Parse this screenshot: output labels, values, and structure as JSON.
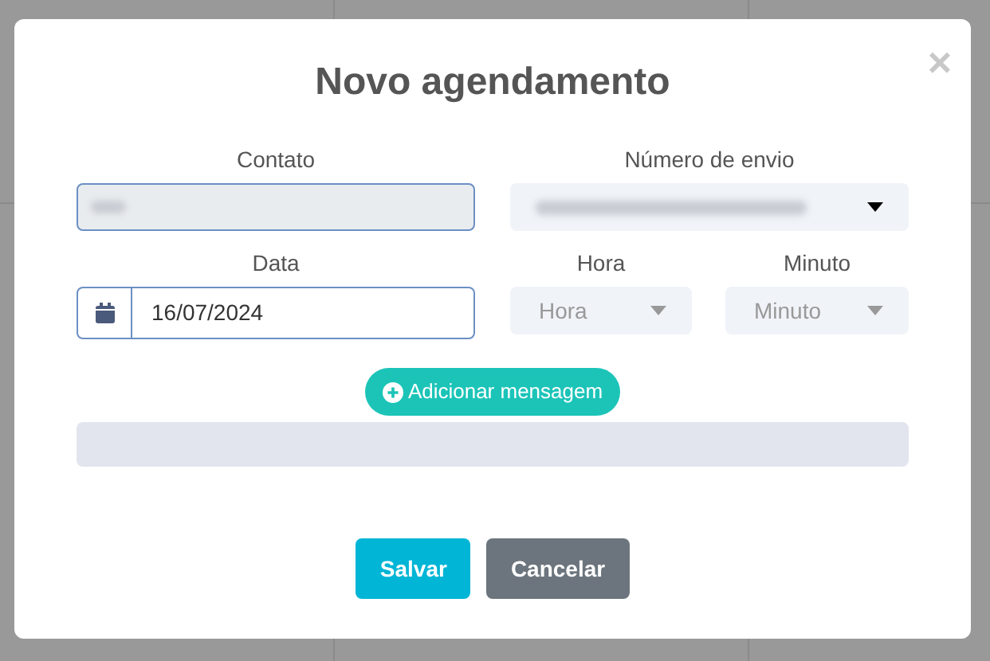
{
  "dialog": {
    "title": "Novo agendamento",
    "close": "×"
  },
  "fields": [
    {
      "kind": "text",
      "label": "Contato"
    },
    {
      "kind": "select",
      "label": "Número de envio"
    },
    {
      "kind": "date",
      "label": "Data",
      "value": "16/07/2024"
    },
    {
      "kind": "placeholder-select",
      "label": "Hora",
      "placeholder": "Hora"
    },
    {
      "kind": "placeholder-select",
      "label": "Minuto",
      "placeholder": "Minuto"
    }
  ],
  "add_message": "Adicionar mensagem",
  "buttons": [
    {
      "label": "Salvar",
      "kind": "primary"
    },
    {
      "label": "Cancelar",
      "kind": "secondary"
    }
  ]
}
